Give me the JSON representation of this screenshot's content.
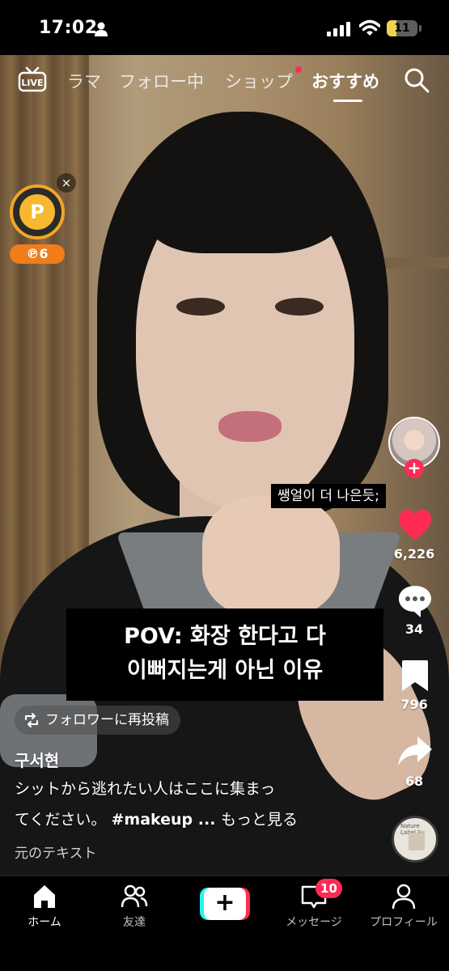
{
  "status_bar": {
    "time": "17:02",
    "battery": "11"
  },
  "top_nav": {
    "tabs": [
      {
        "label": "ラマ"
      },
      {
        "label": "フォロー中"
      },
      {
        "label": "ショップ"
      },
      {
        "label": "おすすめ"
      }
    ],
    "active_tab": "おすすめ"
  },
  "coin_widget": {
    "points": "℗6",
    "close": "×",
    "coin_symbol": "P"
  },
  "comment_overlay": "쌩얼이 더 나은듯;",
  "caption": {
    "line1": "POV: 화장 한다고 다",
    "line2": "이뻐지는게 아닌 이유"
  },
  "actions": {
    "likes": "6,226",
    "comments": "34",
    "saves": "796",
    "shares": "68"
  },
  "repost_label": "フォロワーに再投稿",
  "post": {
    "username": "구서현",
    "desc_line1": "シットから逃れたい人はここに集まっ",
    "desc_line2_text": "てください。 ",
    "hashtag": "#makeup ... ",
    "more": "もっと見る",
    "translate": "元のテキスト"
  },
  "music_label": "Nature Label Su",
  "bottom_nav": {
    "home": "ホーム",
    "friends": "友達",
    "inbox": "メッセージ",
    "inbox_badge": "10",
    "profile": "プロフィール"
  },
  "colors": {
    "accent_red": "#fe2c55",
    "accent_cyan": "#25f4ee",
    "coin_gold": "#f5b82e"
  }
}
